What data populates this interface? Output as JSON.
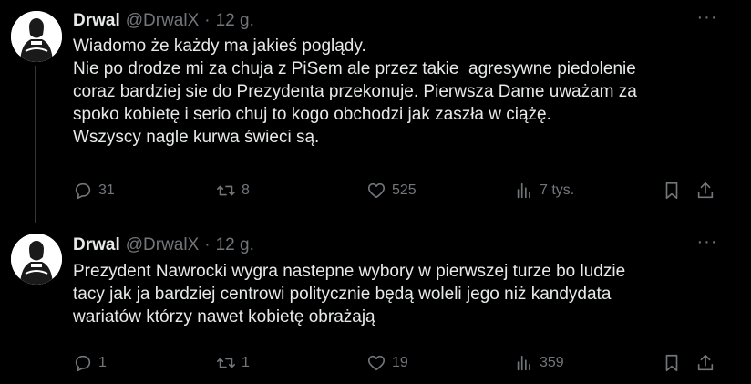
{
  "tweets": [
    {
      "name": "Drwal",
      "handle": "@DrwalX",
      "separator": "·",
      "time": "12 g.",
      "more": "···",
      "lines": [
        "Wiadomo że każdy ma jakieś poglądy.",
        "Nie po drodze mi za chuja z PiSem ale przez takie  agresywne piedolenie",
        "coraz bardziej sie do Prezydenta przekonuje. Pierwsza Dame uważam za",
        "spoko kobietę i serio chuj to kogo obchodzi jak zaszła w ciążę.",
        "Wszyscy nagle kurwa świeci są."
      ],
      "replies": "31",
      "retweets": "8",
      "likes": "525",
      "views": "7 tys."
    },
    {
      "name": "Drwal",
      "handle": "@DrwalX",
      "separator": "·",
      "time": "12 g.",
      "more": "···",
      "lines": [
        "Prezydent Nawrocki wygra nastepne wybory w pierwszej turze bo ludzie",
        "tacy jak ja bardziej centrowi politycznie będą woleli jego niż kandydata",
        "wariatów którzy nawet kobietę obrażają"
      ],
      "replies": "1",
      "retweets": "1",
      "likes": "19",
      "views": "359"
    }
  ],
  "icons": {
    "reply": "reply-icon",
    "retweet": "retweet-icon",
    "like": "heart-icon",
    "views": "views-icon",
    "bookmark": "bookmark-icon",
    "share": "share-icon",
    "more": "more-icon"
  },
  "colors": {
    "background": "#000000",
    "text": "#e7e9ea",
    "muted": "#71767b",
    "thread_line": "#333639"
  }
}
